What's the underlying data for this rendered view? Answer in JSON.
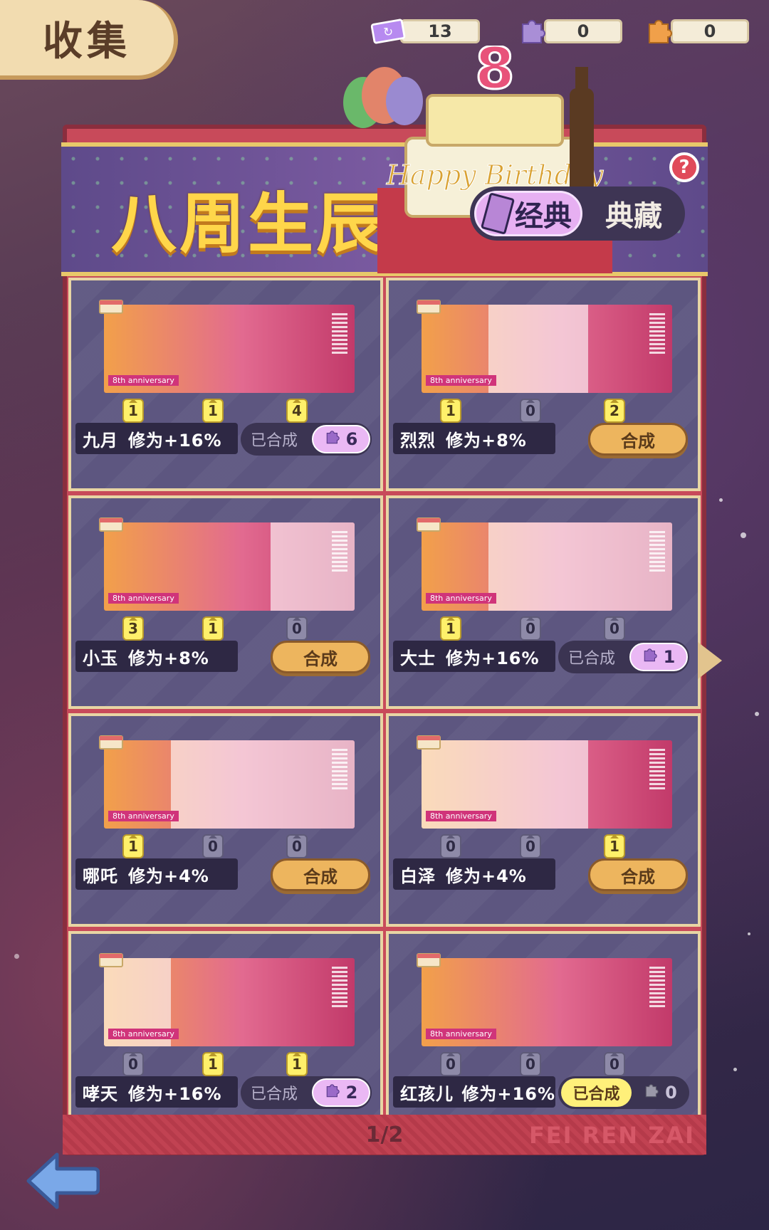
{
  "header": {
    "title": "收集"
  },
  "currency": [
    {
      "icon": "ticket-icon",
      "value": "13",
      "color": "#b78af0"
    },
    {
      "icon": "purple-puzzle-icon",
      "value": "0",
      "color": "#a98ed6"
    },
    {
      "icon": "orange-puzzle-icon",
      "value": "0",
      "color": "#f0a04a"
    }
  ],
  "banner": {
    "title": "八周生辰",
    "cake_text": "Happy Birthday",
    "cake_number": "8",
    "help": "?",
    "tabs": [
      {
        "label": "经典",
        "selected": true
      },
      {
        "label": "典藏",
        "selected": false
      }
    ]
  },
  "cards": [
    {
      "name": "九月",
      "bonus": "修为+16%",
      "counts": [
        "1",
        "1",
        "4"
      ],
      "status": "merged",
      "merged_label": "已合成",
      "merged_count": "6",
      "ghost": [
        false,
        false,
        false
      ]
    },
    {
      "name": "烈烈",
      "bonus": "修为+8%",
      "counts": [
        "1",
        "0",
        "2"
      ],
      "status": "merge",
      "merge_label": "合成",
      "ghost": [
        false,
        true,
        false
      ]
    },
    {
      "name": "小玉",
      "bonus": "修为+8%",
      "counts": [
        "3",
        "1",
        "0"
      ],
      "status": "merge",
      "merge_label": "合成",
      "ghost": [
        false,
        false,
        true
      ]
    },
    {
      "name": "大士",
      "bonus": "修为+16%",
      "counts": [
        "1",
        "0",
        "0"
      ],
      "status": "merged",
      "merged_label": "已合成",
      "merged_count": "1",
      "ghost": [
        false,
        true,
        true
      ]
    },
    {
      "name": "哪吒",
      "bonus": "修为+4%",
      "counts": [
        "1",
        "0",
        "0"
      ],
      "status": "merge",
      "merge_label": "合成",
      "ghost": [
        false,
        true,
        true
      ]
    },
    {
      "name": "白泽",
      "bonus": "修为+4%",
      "counts": [
        "0",
        "0",
        "1"
      ],
      "status": "merge",
      "merge_label": "合成",
      "ghost": [
        true,
        true,
        false
      ]
    },
    {
      "name": "哮天",
      "bonus": "修为+16%",
      "counts": [
        "0",
        "1",
        "1"
      ],
      "status": "merged",
      "merged_label": "已合成",
      "merged_count": "2",
      "ghost": [
        true,
        false,
        false
      ]
    },
    {
      "name": "红孩儿",
      "bonus": "修为+16%",
      "counts": [
        "0",
        "0",
        "0"
      ],
      "status": "merged_gold",
      "merged_label": "已合成",
      "merged_count": "0",
      "ghost": [
        false,
        false,
        false
      ]
    }
  ],
  "card_ribbon": "8th anniversary",
  "footer": {
    "page": "1/2",
    "watermark": "FEI REN ZAI"
  }
}
